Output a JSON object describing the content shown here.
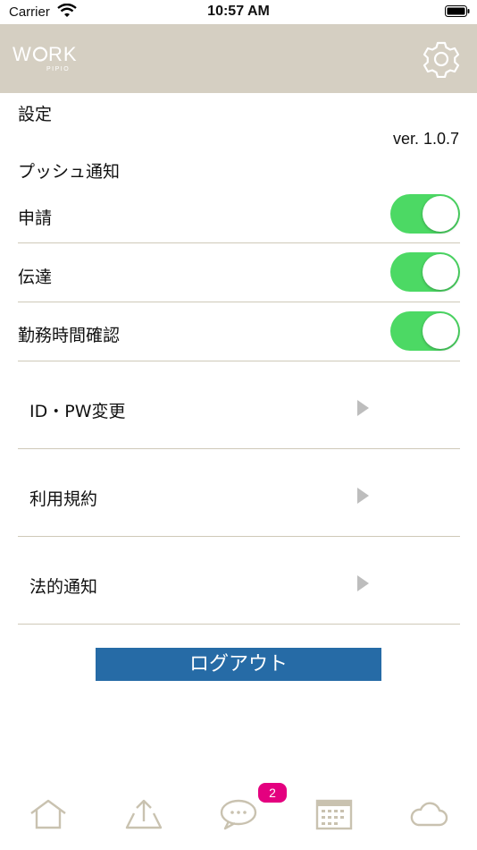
{
  "status_bar": {
    "carrier": "Carrier",
    "time": "10:57 AM"
  },
  "header": {
    "logo_text": "WORK PIPIO",
    "settings_icon": "gear-icon"
  },
  "settings": {
    "title": "設定",
    "version": "ver. 1.0.7",
    "push_title": "プッシュ通知",
    "toggles": [
      {
        "label": "申請",
        "on": true
      },
      {
        "label": "伝達",
        "on": true
      },
      {
        "label": "勤務時間確認",
        "on": true
      }
    ],
    "menu": [
      {
        "label": "ID・PW変更"
      },
      {
        "label": "利用規約"
      },
      {
        "label": "法的通知"
      }
    ],
    "logout_label": "ログアウト"
  },
  "tab_bar": {
    "items": [
      "home-icon",
      "upload-icon",
      "chat-icon",
      "calendar-icon",
      "cloud-icon"
    ],
    "chat_badge": "2",
    "icon_color": "#c9c2b0",
    "badge_color": "#e4007f"
  },
  "colors": {
    "header_bg": "#d5cfc2",
    "toggle_on": "#4cd964",
    "logout_bg": "#266ba6"
  }
}
